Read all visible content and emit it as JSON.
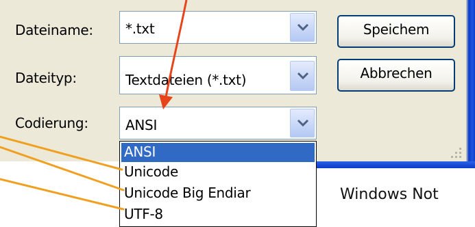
{
  "form": {
    "filename_label": "Dateiname:",
    "filename_value": "*.txt",
    "filetype_label": "Dateityp:",
    "filetype_value": "Textdateien (*.txt)",
    "encoding_label": "Codierung:",
    "encoding_value": "ANSI"
  },
  "buttons": {
    "save_label": "Speichem",
    "cancel_label": "Abbrechen"
  },
  "encoding_options": [
    "ANSI",
    "Unicode",
    "Unicode Big Endiar",
    "UTF-8"
  ],
  "caption": "Windows Not",
  "colors": {
    "dialog_bg": "#ece9d8",
    "selection_bg": "#316ac5",
    "window_frame": "#0a3bc9",
    "arrow_red": "#e8441c",
    "arrow_orange": "#f0a020"
  },
  "icons": {
    "dropdown": "chevron-down-icon",
    "resize": "resize-grip-icon"
  }
}
